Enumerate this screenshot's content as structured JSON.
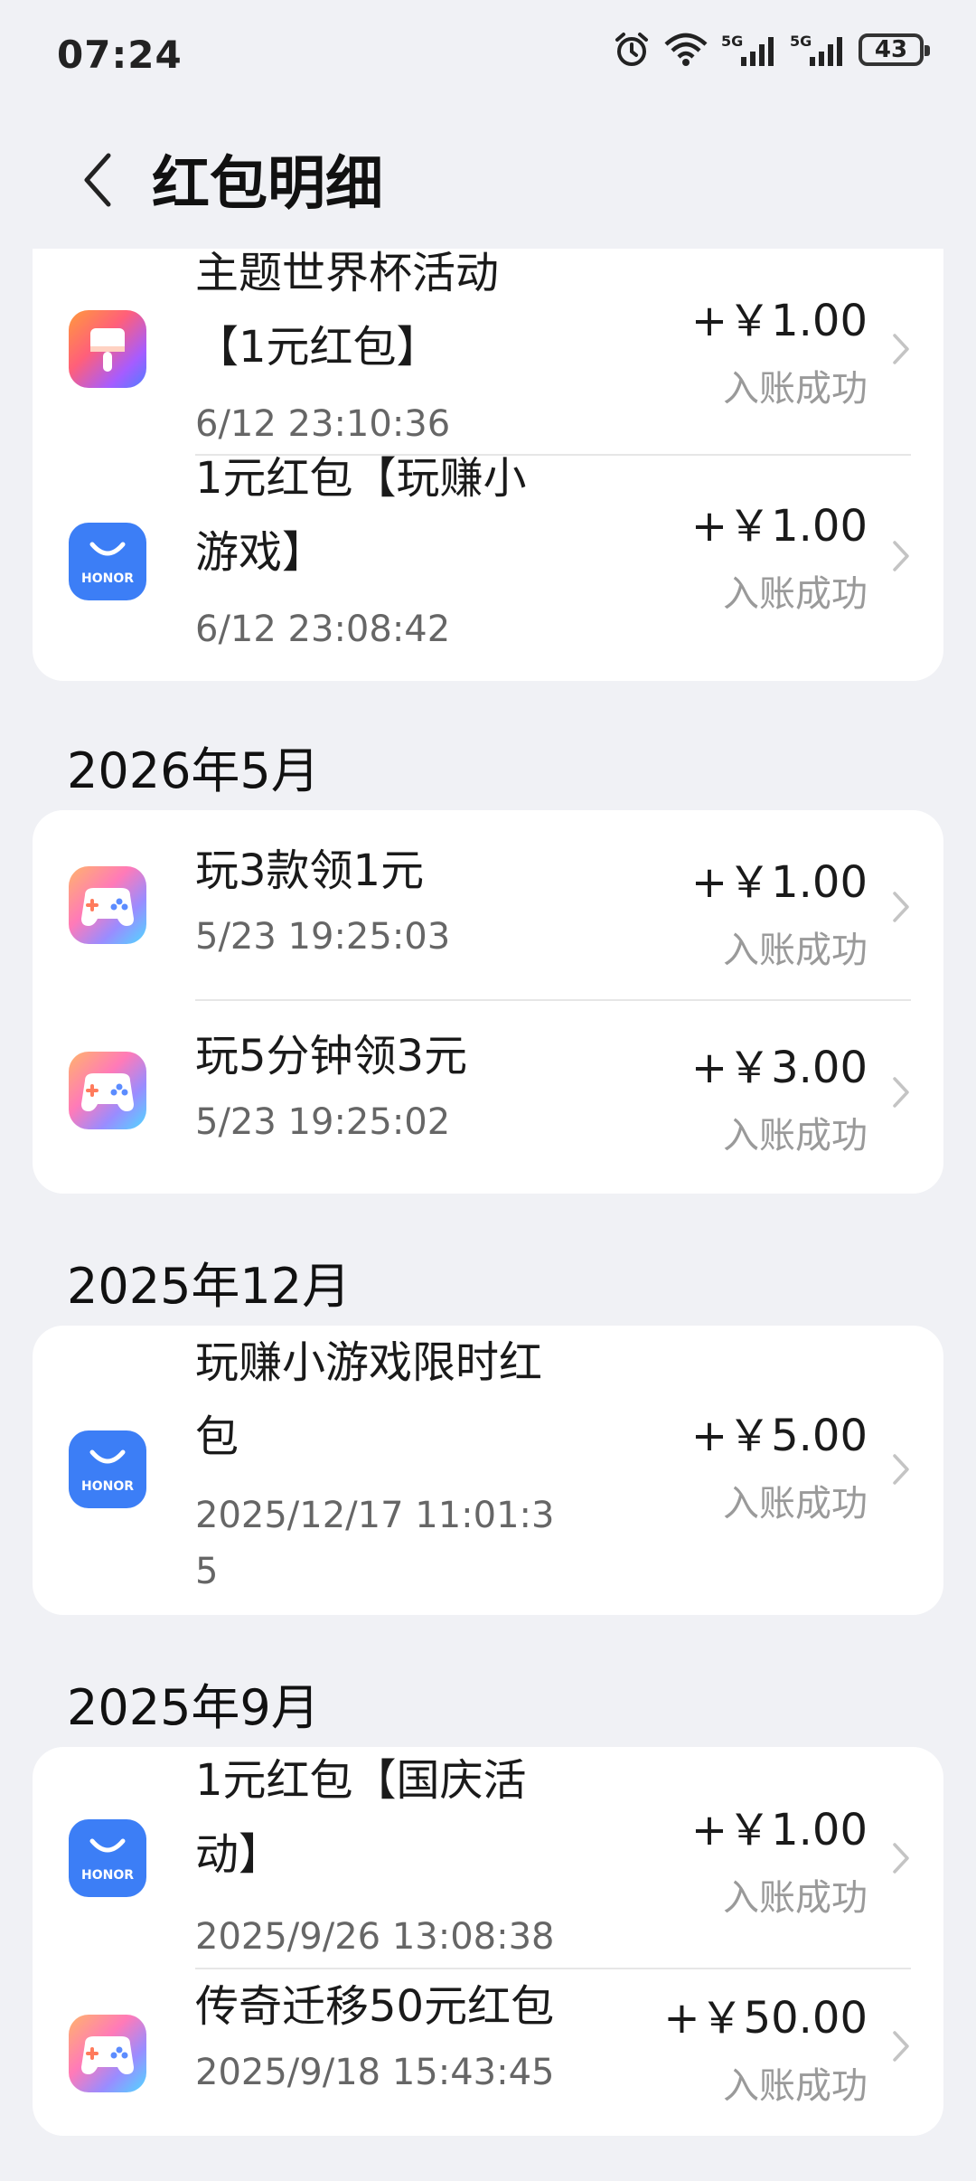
{
  "status_bar": {
    "time": "07:24",
    "battery": "43",
    "network1": "5G",
    "network2": "5G"
  },
  "header": {
    "title": "红包明细"
  },
  "top_card": {
    "items": [
      {
        "title_line1": "主题世界杯活动",
        "title_line2": "【1元红包】",
        "date": "6/12 23:10:36",
        "amount": "+￥1.00",
        "status": "入账成功",
        "icon": "theme-brush-icon"
      },
      {
        "title_line1": "1元红包【玩赚小",
        "title_line2": "游戏】",
        "date": "6/12 23:08:42",
        "amount": "+￥1.00",
        "status": "入账成功",
        "icon": "honor-bag-icon"
      }
    ]
  },
  "sections": [
    {
      "month": "2026年5月",
      "items": [
        {
          "title_line1": "玩3款领1元",
          "date": "5/23 19:25:03",
          "amount": "+￥1.00",
          "status": "入账成功",
          "icon": "gamepad-icon"
        },
        {
          "title_line1": "玩5分钟领3元",
          "date": "5/23 19:25:02",
          "amount": "+￥3.00",
          "status": "入账成功",
          "icon": "gamepad-icon"
        }
      ]
    },
    {
      "month": "2025年12月",
      "items": [
        {
          "title_line1": "玩赚小游戏限时红",
          "title_line2": "包",
          "date_line1": "2025/12/17 11:01:3",
          "date_line2": "5",
          "amount": "+￥5.00",
          "status": "入账成功",
          "icon": "honor-bag-icon"
        }
      ]
    },
    {
      "month": "2025年9月",
      "items": [
        {
          "title_line1": "1元红包【国庆活",
          "title_line2": "动】",
          "date": "2025/9/26 13:08:38",
          "amount": "+￥1.00",
          "status": "入账成功",
          "icon": "honor-bag-icon"
        },
        {
          "title_line1": "传奇迁移50元红包",
          "date": "2025/9/18 15:43:45",
          "amount": "+￥50.00",
          "status": "入账成功",
          "icon": "gamepad-icon"
        }
      ]
    }
  ],
  "icon_labels": {
    "honor": "HONOR"
  }
}
